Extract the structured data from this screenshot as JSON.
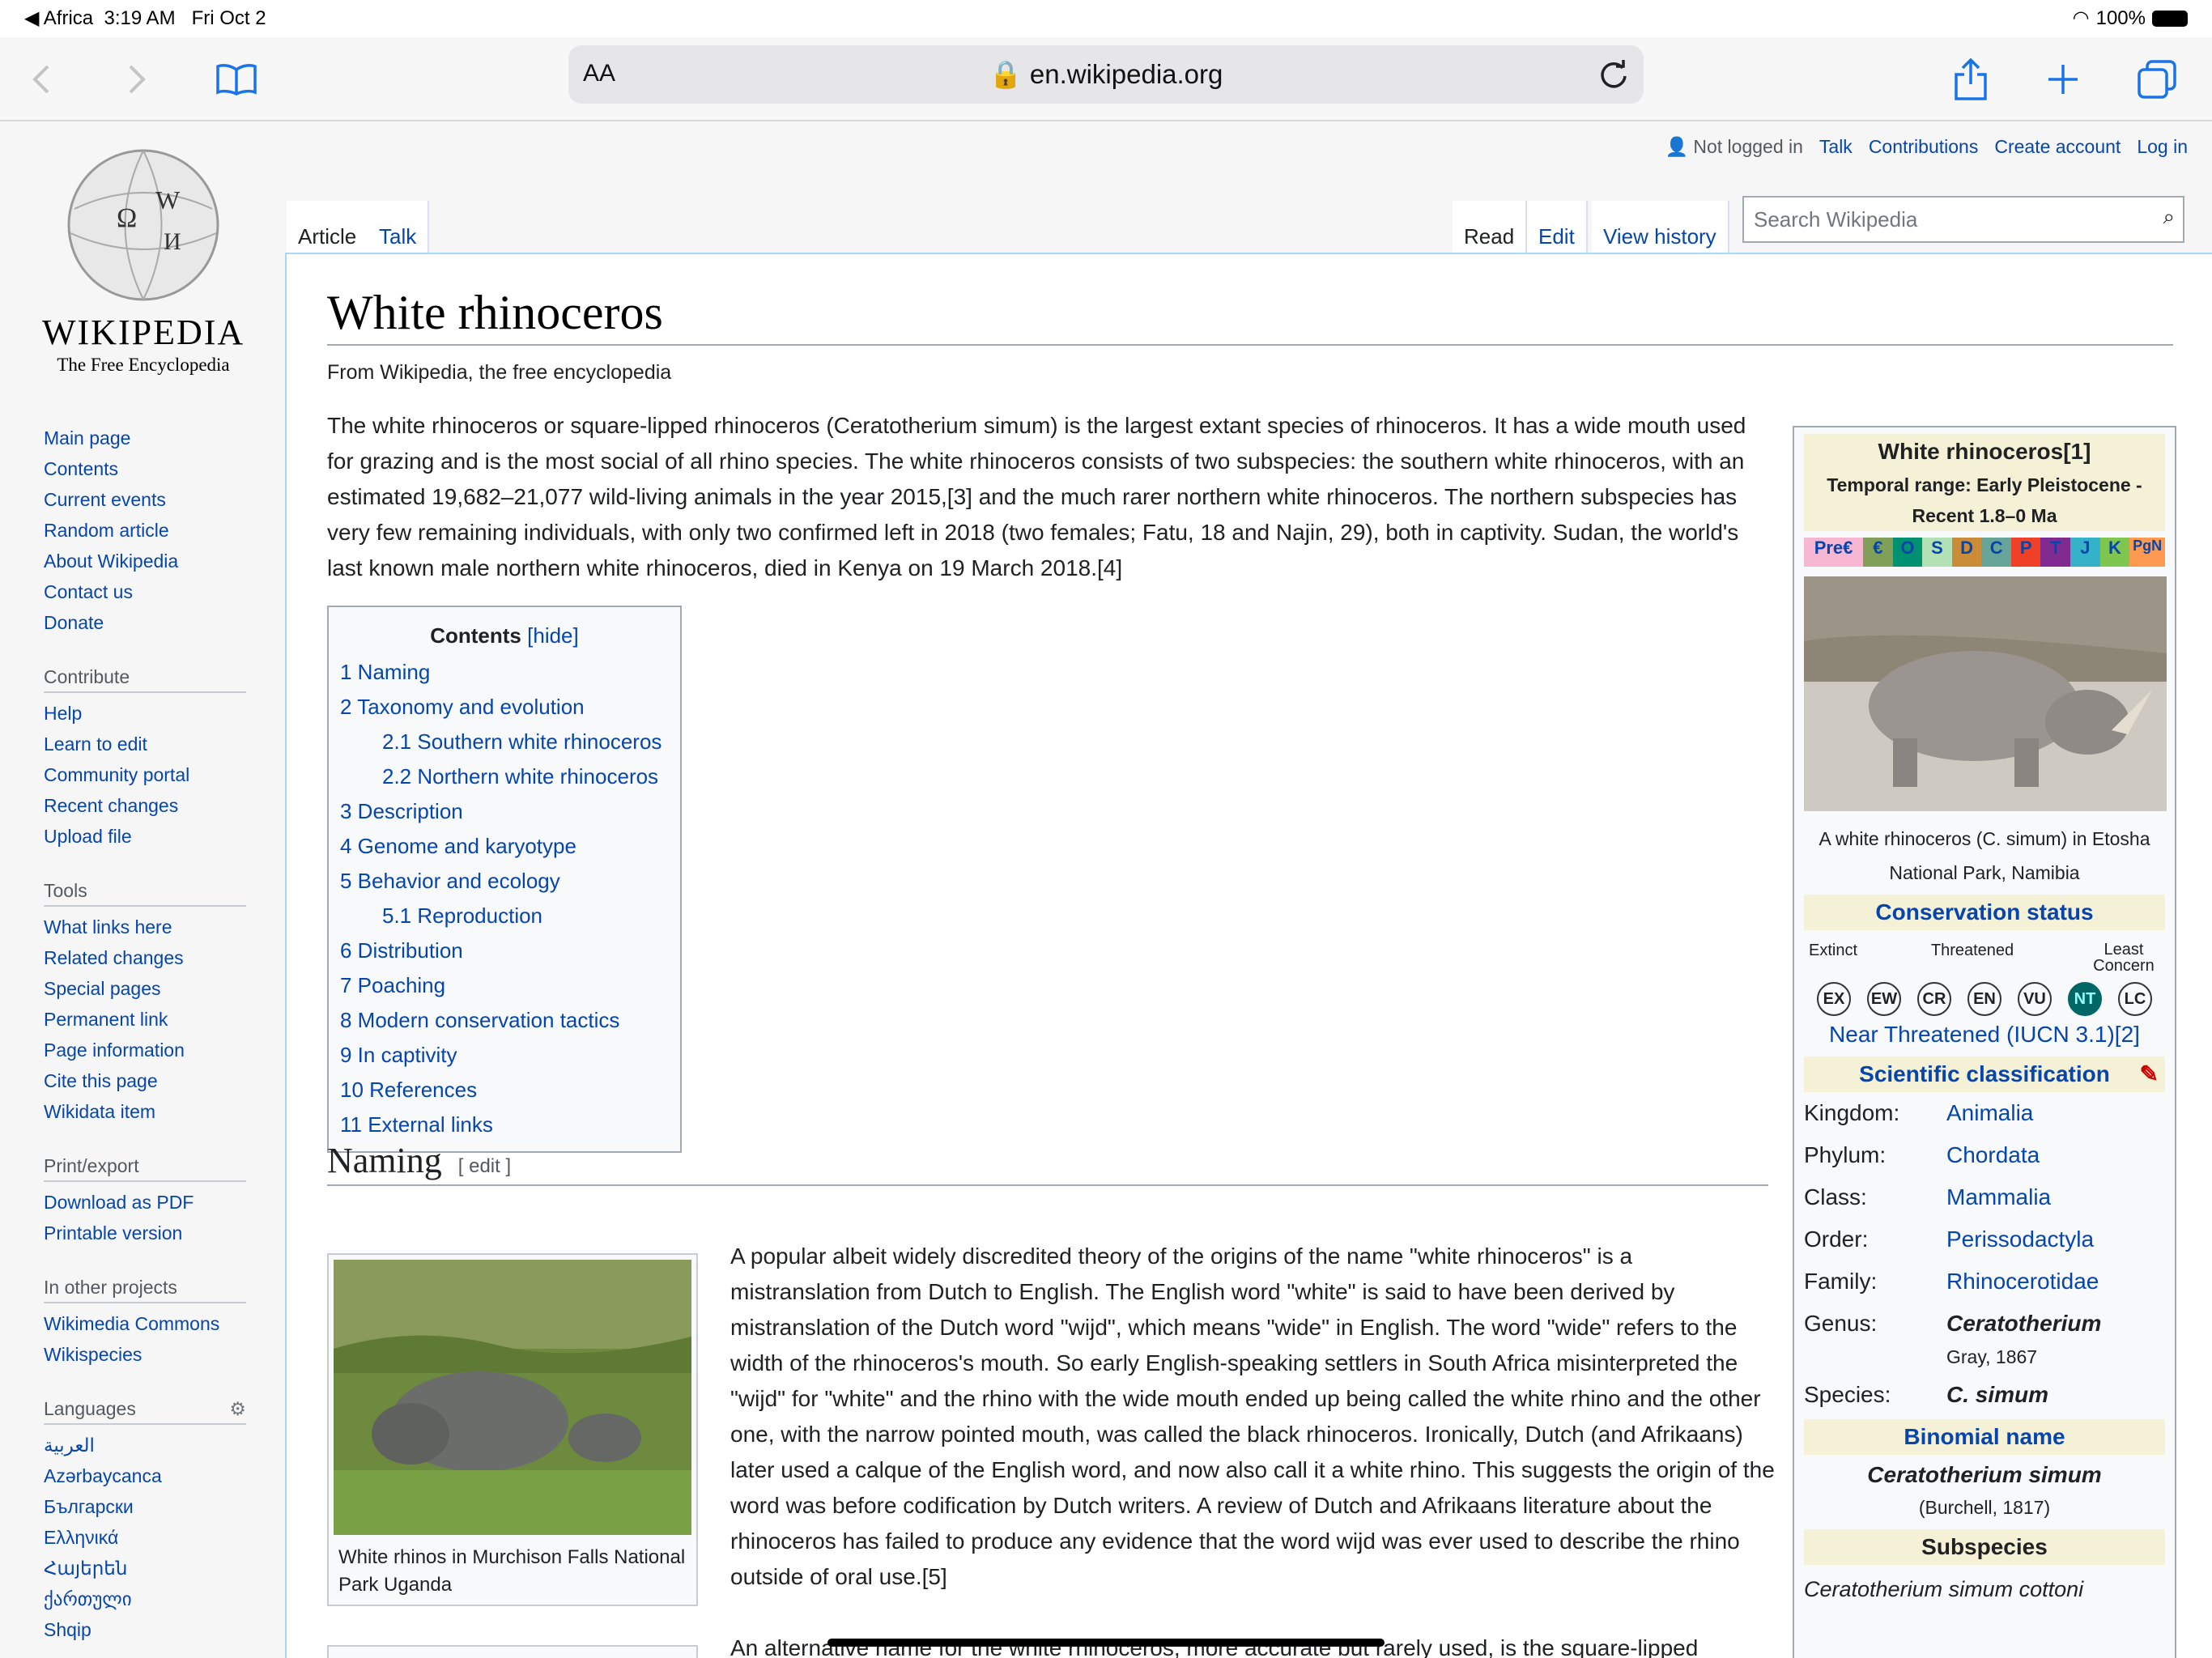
{
  "status": {
    "carrier": "◀ Africa",
    "time": "3:19 AM",
    "date": "Fri Oct 2",
    "battery": "100%"
  },
  "browser": {
    "aa": "AA",
    "host": "en.wikipedia.org"
  },
  "wiki": {
    "wordmark": "WIKIPEDIA",
    "tagline": "The Free Encyclopedia",
    "personal": [
      "Not logged in",
      "Talk",
      "Contributions",
      "Create account",
      "Log in"
    ],
    "tabs_left": [
      "Article",
      "Talk"
    ],
    "tabs_right": [
      "Read",
      "Edit",
      "View history"
    ],
    "search_placeholder": "Search Wikipedia",
    "nav": [
      "Main page",
      "Contents",
      "Current events",
      "Random article",
      "About Wikipedia",
      "Contact us",
      "Donate"
    ],
    "contribute_head": "Contribute",
    "contribute": [
      "Help",
      "Learn to edit",
      "Community portal",
      "Recent changes",
      "Upload file"
    ],
    "tools_head": "Tools",
    "tools": [
      "What links here",
      "Related changes",
      "Special pages",
      "Permanent link",
      "Page information",
      "Cite this page",
      "Wikidata item"
    ],
    "print_head": "Print/export",
    "print": [
      "Download as PDF",
      "Printable version"
    ],
    "projects_head": "In other projects",
    "projects": [
      "Wikimedia Commons",
      "Wikispecies"
    ],
    "lang_head": "Languages",
    "langs": [
      "العربية",
      "Azərbaycanca",
      "Български",
      "Ελληνικά",
      "Հայերեն",
      "ქართული",
      "Shqip"
    ]
  },
  "article": {
    "title": "White rhinoceros",
    "from": "From Wikipedia, the free encyclopedia",
    "lead": "The white rhinoceros or square-lipped rhinoceros (Ceratotherium simum) is the largest extant species of rhinoceros. It has a wide mouth used for grazing and is the most social of all rhino species. The white rhinoceros consists of two subspecies: the southern white rhinoceros, with an estimated 19,682–21,077 wild-living animals in the year 2015,[3] and the much rarer northern white rhinoceros. The northern subspecies has very few remaining individuals, with only two confirmed left in 2018 (two females; Fatu, 18 and Najin, 29), both in captivity. Sudan, the world's last known male northern white rhinoceros, died in Kenya on 19 March 2018.[4]",
    "toc_title": "Contents",
    "toc_hide": "[hide]",
    "toc": [
      "1 Naming",
      "2 Taxonomy and evolution",
      "2.1 Southern white rhinoceros",
      "2.2 Northern white rhinoceros",
      "3 Description",
      "4 Genome and karyotype",
      "5 Behavior and ecology",
      "5.1 Reproduction",
      "6 Distribution",
      "7 Poaching",
      "8 Modern conservation tactics",
      "9 In captivity",
      "10 References",
      "11 External links"
    ],
    "naming": "Naming",
    "edit": "[ edit ]",
    "thumb_caption": "White rhinos in Murchison Falls National Park Uganda",
    "naming_text": "A popular albeit widely discredited theory of the origins of the name \"white rhinoceros\" is a mistranslation from Dutch to English. The English word \"white\" is said to have been derived by mistranslation of the Dutch word \"wijd\", which means \"wide\" in English. The word \"wide\" refers to the width of the rhinoceros's mouth. So early English-speaking settlers in South Africa misinterpreted the \"wijd\" for \"white\" and the rhino with the wide mouth ended up being called the white rhino and the other one, with the narrow pointed mouth, was called the black rhinoceros. Ironically, Dutch (and Afrikaans) later used a calque of the English word, and now also call it a white rhino. This suggests the origin of the word was before codification by Dutch writers. A review of Dutch and Afrikaans literature about the rhinoceros has failed to produce any evidence that the word wijd was ever used to describe the rhino outside of oral use.[5]",
    "naming_text2": "An alternative name for the white rhinoceros, more accurate but rarely used, is the square-lipped"
  },
  "infobox": {
    "name": "White rhinoceros[1]",
    "range": "Temporal range: Early Pleistocene - Recent 1.8–0 Ma",
    "periods": [
      "Pre€",
      "€",
      "O",
      "S",
      "D",
      "C",
      "P",
      "T",
      "J",
      "K",
      "PgN"
    ],
    "caption": "A white rhinoceros (C. simum) in Etosha National Park, Namibia",
    "cons_head": "Conservation status",
    "iucn": [
      "EX",
      "EW",
      "CR",
      "EN",
      "VU",
      "NT",
      "LC"
    ],
    "scale_labels": [
      "Extinct",
      "Threatened",
      "Least Concern"
    ],
    "status": "Near Threatened (IUCN 3.1)[2]",
    "sci_head": "Scientific classification",
    "rows": [
      [
        "Kingdom:",
        "Animalia"
      ],
      [
        "Phylum:",
        "Chordata"
      ],
      [
        "Class:",
        "Mammalia"
      ],
      [
        "Order:",
        "Perissodactyla"
      ],
      [
        "Family:",
        "Rhinocerotidae"
      ],
      [
        "Genus:",
        "Ceratotherium"
      ]
    ],
    "genus_auth": "Gray, 1867",
    "species_k": "Species:",
    "species_v": "C. simum",
    "binomial_head": "Binomial name",
    "binomial": "Ceratotherium simum",
    "binomial_auth": "(Burchell, 1817)",
    "subspecies_head": "Subspecies",
    "subspecies": "Ceratotherium simum cottoni"
  }
}
